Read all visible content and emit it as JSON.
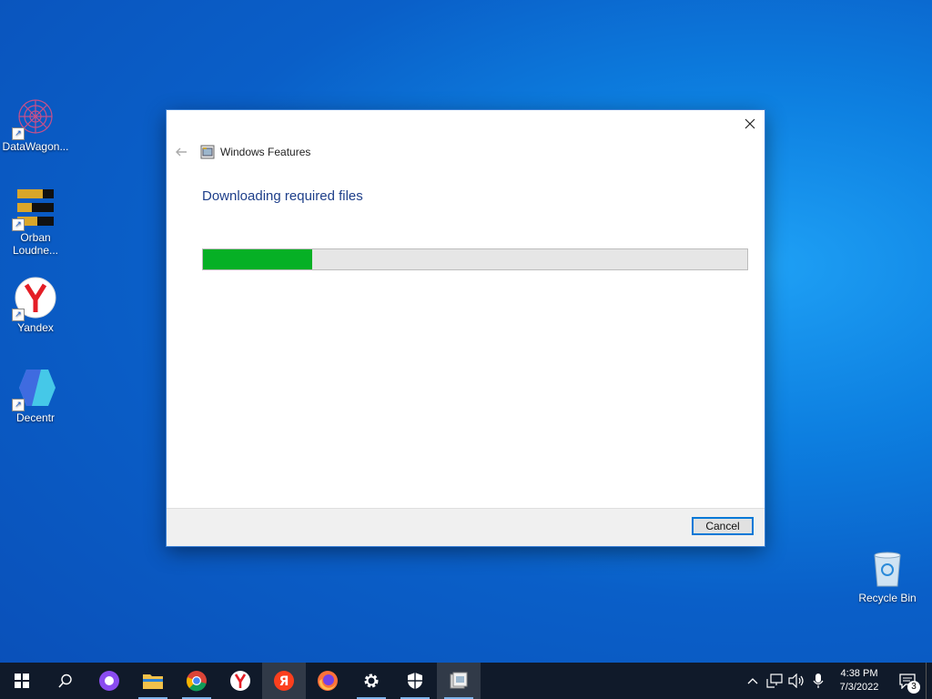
{
  "desktop": {
    "icons": [
      {
        "label": "DataWagon..."
      },
      {
        "label": "Orban Loudne..."
      },
      {
        "label": "Yandex"
      },
      {
        "label": "Decentr"
      },
      {
        "label": "Recycle Bin"
      }
    ]
  },
  "dialog": {
    "title": "Windows Features",
    "heading": "Downloading required files",
    "progress_fraction": 0.2,
    "cancel_label": "Cancel",
    "progress_color": "#06b025",
    "heading_color": "#1e3f8a"
  },
  "taskbar": {
    "apps": [
      "start-icon",
      "search-icon",
      "alice-icon",
      "file-explorer-icon",
      "chrome-icon",
      "yandex-browser-icon",
      "yandex-icon",
      "firefox-icon",
      "settings-icon",
      "security-icon",
      "windows-features-icon"
    ],
    "clock_time": "4:38 PM",
    "clock_date": "7/3/2022",
    "notification_count": "3"
  }
}
